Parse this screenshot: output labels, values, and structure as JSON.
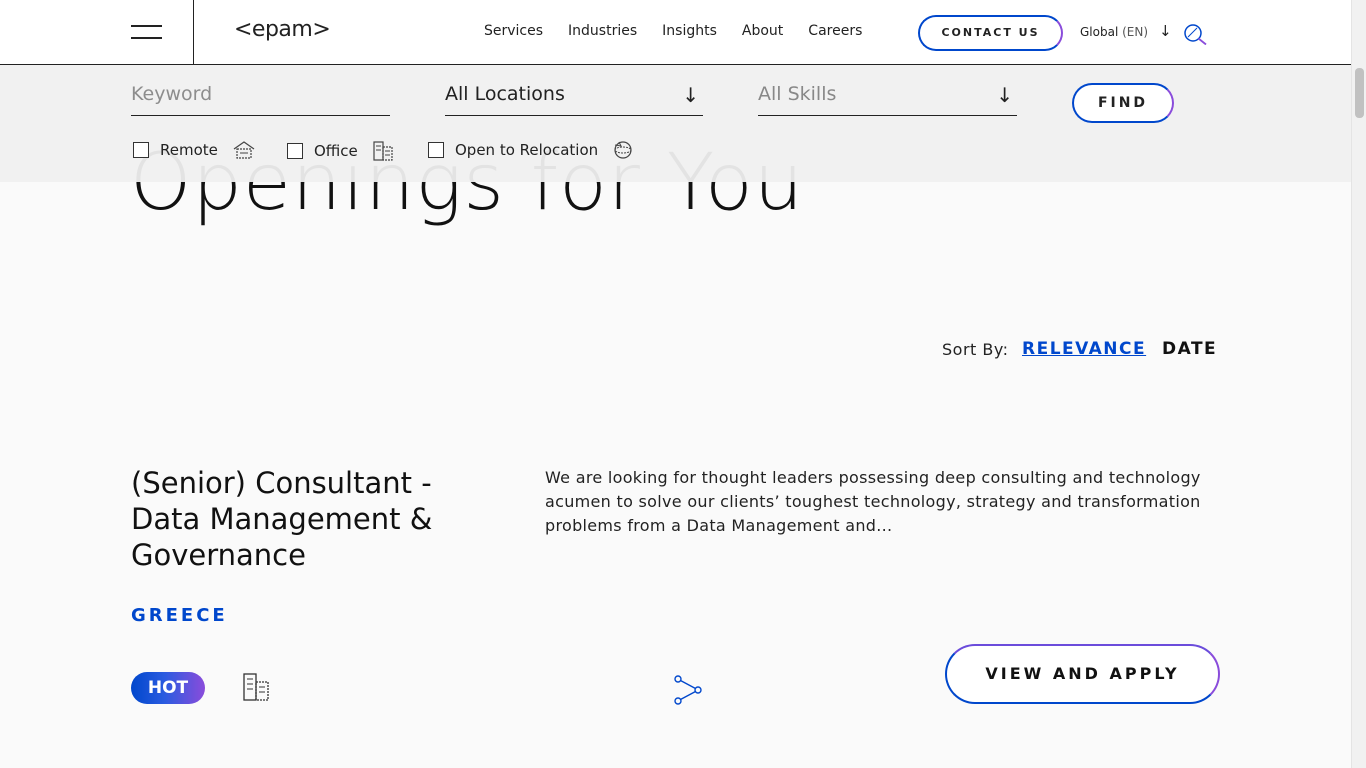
{
  "header": {
    "logo": "<epam>",
    "nav": [
      "Services",
      "Industries",
      "Insights",
      "About",
      "Careers"
    ],
    "contact_label": "CONTACT US",
    "lang_label": "Global",
    "lang_code": "(EN)"
  },
  "heading": {
    "text": "Openings for You"
  },
  "filters": {
    "keyword_placeholder": "Keyword",
    "locations_value": "All Locations",
    "skills_placeholder": "All Skills",
    "find_label": "FIND",
    "options": [
      {
        "label": "Remote",
        "checked": false,
        "icon": "home-icon"
      },
      {
        "label": "Office",
        "checked": false,
        "icon": "building-icon"
      },
      {
        "label": "Open to Relocation",
        "checked": false,
        "icon": "globe-icon"
      }
    ]
  },
  "sort": {
    "label": "Sort By:",
    "relevance": "RELEVANCE",
    "date": "DATE",
    "active": "RELEVANCE"
  },
  "job": {
    "title": "(Senior) Consultant - Data Management & Governance",
    "country": "GREECE",
    "description": "We are looking for thought leaders possessing deep consulting and technology acumen to solve our clients’ toughest technology, strategy and transformation problems from a Data Management and...",
    "badge": "HOT",
    "work_type_icon": "building-icon",
    "share_icon": "share-icon",
    "apply_label": "VIEW AND APPLY"
  },
  "colors": {
    "accent_blue": "#0047cc",
    "accent_purple": "#8a4cdb"
  }
}
